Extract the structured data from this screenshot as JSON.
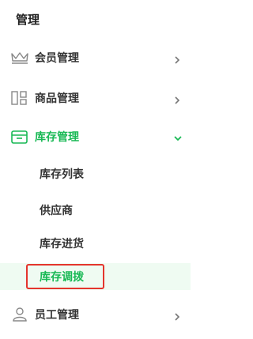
{
  "section_title": "管理",
  "menu": [
    {
      "label": "会员管理",
      "icon": "crown-icon"
    },
    {
      "label": "商品管理",
      "icon": "grid-layout-icon"
    },
    {
      "label": "库存管理",
      "icon": "box-icon",
      "expanded": true
    },
    {
      "label": "员工管理",
      "icon": "user-icon"
    }
  ],
  "inventory_sub": [
    {
      "label": "库存列表"
    },
    {
      "label": "供应商"
    },
    {
      "label": "库存进货"
    },
    {
      "label": "库存调拨",
      "selected": true
    }
  ],
  "colors": {
    "accent": "#19b955",
    "selected_bg": "#effbf2",
    "highlight_border": "#e4352d",
    "icon_gray": "#888888"
  }
}
